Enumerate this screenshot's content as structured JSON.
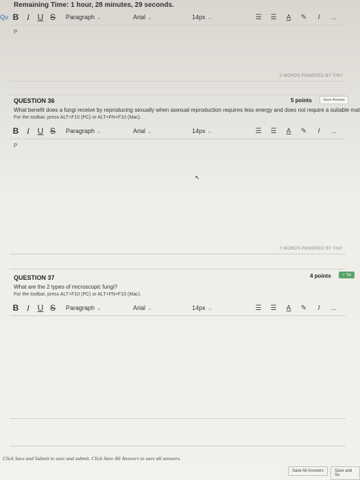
{
  "timer": {
    "text": "Remaining Time: 1 hour, 28 minutes, 29 seconds."
  },
  "question_link": "Qu",
  "toolbar": {
    "bold": "B",
    "italic": "I",
    "underline": "U",
    "strike": "S",
    "paragraph": "Paragraph",
    "font": "Arial",
    "size": "14px",
    "chevron": "‹",
    "bullets_icon": "☰",
    "numbered_icon": "☰",
    "text_color_icon": "A",
    "highlight_icon": "✎",
    "clear_format_icon": "I",
    "more_icon": "..."
  },
  "editor_top": {
    "p": "P",
    "word_count": "0 WORDS  POWERED BY TINY"
  },
  "q36": {
    "title": "QUESTION 36",
    "points": "5 points",
    "save": "Save Answer",
    "text": "What benefit does a fungi receive by reproducing sexually when asexual reproduction requires less energy and does not require a suitable mate?",
    "toolbar_hint": "For the toolbar, press ALT+F10 (PC) or ALT+FN+F10 (Mac).",
    "editor_p": "P",
    "word_count": "0 WORDS  POWERED BY TINY"
  },
  "q37": {
    "title": "QUESTION 37",
    "points": "4 points",
    "save": "✓ Sa",
    "text": "What are the 2 types of microscopic fungi?",
    "toolbar_hint": "For the toolbar, press ALT+F10 (PC) or ALT+FN+F10 (Mac)."
  },
  "footer": {
    "note": "Click Save and Submit to save and submit. Click Save All Answers to save all answers.",
    "save_all": "Save All Answers",
    "save_submit": "Save and Su"
  }
}
